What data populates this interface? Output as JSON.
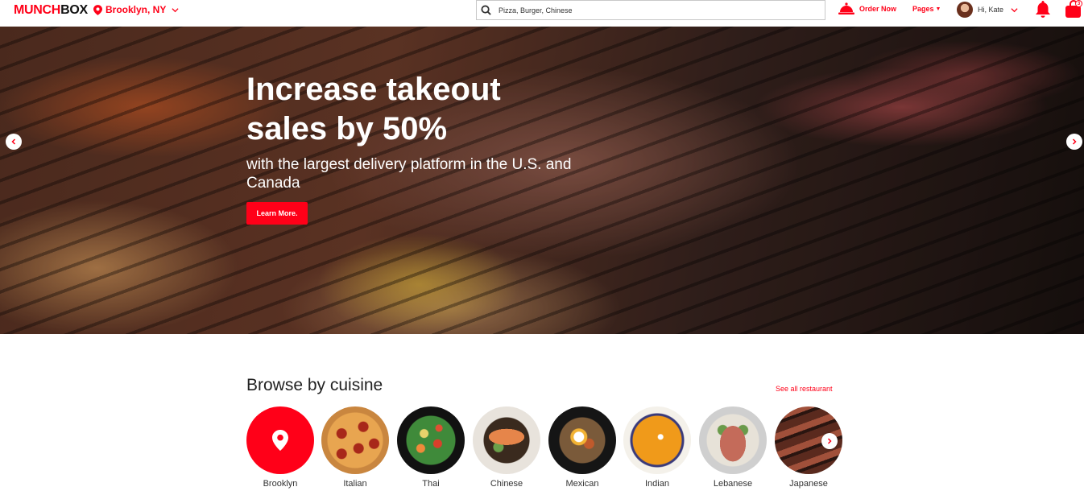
{
  "header": {
    "logo_part1": "MUNCH",
    "logo_part2": "BOX",
    "location": "Brooklyn, NY",
    "search_placeholder": "Pizza, Burger, Chinese",
    "order_now": "Order Now",
    "pages": "Pages",
    "greeting": "Hi, Kate",
    "cart_count": "3"
  },
  "hero": {
    "title": "Increase takeout sales by 50%",
    "subtitle": "with the largest delivery platform in the U.S. and Canada",
    "button": "Learn More."
  },
  "cuisine": {
    "title": "Browse by cuisine",
    "see_all": "See all restaurant",
    "items": [
      {
        "label": "Brooklyn"
      },
      {
        "label": "Italian"
      },
      {
        "label": "Thai"
      },
      {
        "label": "Chinese"
      },
      {
        "label": "Mexican"
      },
      {
        "label": "Indian"
      },
      {
        "label": "Lebanese"
      },
      {
        "label": "Japanese"
      }
    ]
  },
  "colors": {
    "brand": "#ff0018"
  }
}
